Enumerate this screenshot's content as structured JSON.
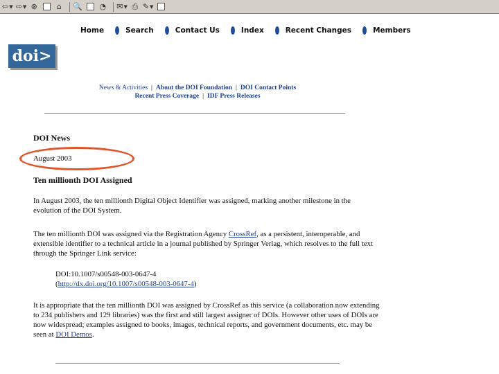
{
  "toolbar": {
    "icons": [
      "back-icon",
      "forward-icon",
      "stop-icon",
      "refresh-icon",
      "home-icon",
      "search-icon",
      "favorites-icon",
      "history-icon",
      "mail-icon",
      "print-icon",
      "edit-icon",
      "discuss-icon"
    ]
  },
  "site_nav": {
    "items": [
      "Home",
      "Search",
      "Contact Us",
      "Index",
      "Recent Changes",
      "Members"
    ]
  },
  "logo": {
    "text": "doi>"
  },
  "sub_links": {
    "row1": [
      "News & Activities",
      "About the DOI Foundation",
      "DOI Contact Points"
    ],
    "row2": [
      "Recent Press Coverage",
      "IDF Press Releases"
    ],
    "separator": "|"
  },
  "news": {
    "heading": "DOI News",
    "date": "August 2003",
    "headline": "Ten millionth DOI Assigned",
    "para1": "In August 2003, the ten millionth Digital Object Identifier was assigned, marking another milestone in the evolution of the DOI System.",
    "para2_before": "The ten millionth DOI was assigned via the Registration Agency ",
    "para2_link": "CrossRef",
    "para2_after": ", as a persistent, interoperable, and extensible identifier to a technical article in a journal published by Springer Verlag, which resolves to the full text through the Springer Link service:",
    "doi_line": "DOI:10.1007/s00548-003-0647-4",
    "doi_link": "http://dx.doi.org/10.1007/s00548-003-0647-4",
    "doi_link_open": "(",
    "doi_link_close": ")",
    "para3_before": "It is appropriate that the ten millionth DOI was assigned by CrossRef as this service (a collaboration now extending to 234 publishers and 129 libraries) was the first and still largest assigner of DOIs. However other uses of DOIs are now widespread; examples assigned to books, images, technical reports, and government documents, etc. may be seen at ",
    "para3_link": "DOI Demos",
    "para3_after": "."
  },
  "colors": {
    "nav_bullet": "#1f4e9a",
    "logo_bg": "#336699",
    "link": "#1f3f8f",
    "highlight": "#e0562a"
  }
}
